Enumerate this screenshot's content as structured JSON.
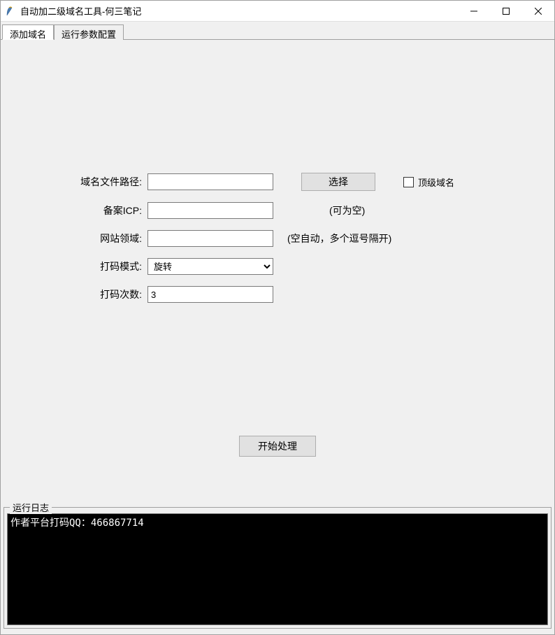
{
  "window": {
    "title": "自动加二级域名工具-何三笔记"
  },
  "tabs": [
    {
      "label": "添加域名",
      "active": true
    },
    {
      "label": "运行参数配置",
      "active": false
    }
  ],
  "form": {
    "domain_file_path": {
      "label": "域名文件路径:",
      "value": ""
    },
    "select_button": "选择",
    "top_domain_checkbox": {
      "label": "顶级域名",
      "checked": false
    },
    "icp": {
      "label": "备案ICP:",
      "value": "",
      "hint": "(可为空)"
    },
    "site_field": {
      "label": "网站领域:",
      "value": "",
      "hint": "(空自动，多个逗号隔开)"
    },
    "code_mode": {
      "label": "打码模式:",
      "value": "旋转",
      "options": [
        "旋转"
      ]
    },
    "code_times": {
      "label": "打码次数:",
      "value": "3"
    },
    "start_button": "开始处理"
  },
  "log": {
    "section_label": "运行日志",
    "content": "作者平台打码QQ：466867714"
  }
}
